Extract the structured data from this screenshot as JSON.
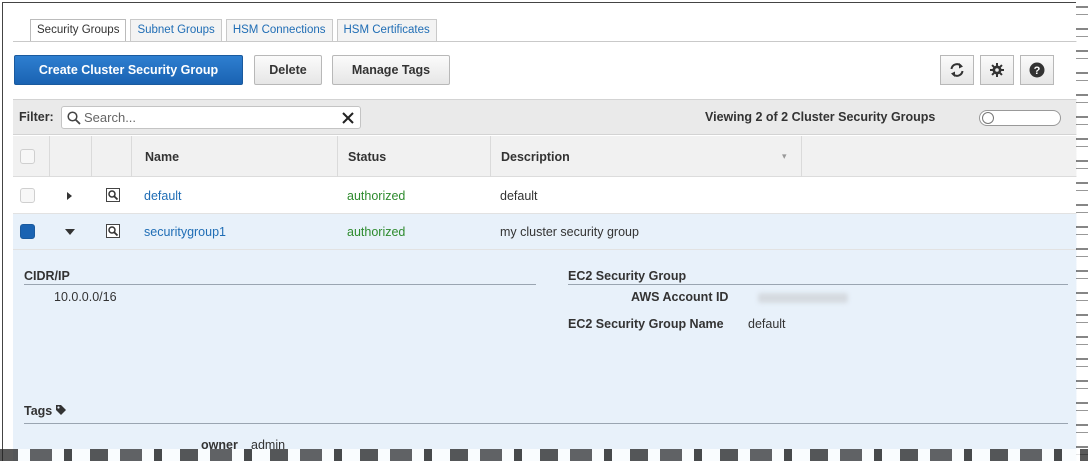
{
  "tabs": [
    "Security Groups",
    "Subnet Groups",
    "HSM Connections",
    "HSM Certificates"
  ],
  "toolbar": {
    "create_label": "Create Cluster Security Group",
    "delete_label": "Delete",
    "manage_tags_label": "Manage Tags"
  },
  "icons": [
    "refresh-icon",
    "gear-icon",
    "help-icon"
  ],
  "filter": {
    "label": "Filter:",
    "search_placeholder": "Search...",
    "viewing": "Viewing 2 of 2 Cluster Security Groups"
  },
  "table": {
    "columns": [
      "Name",
      "Status",
      "Description"
    ],
    "rows": [
      {
        "name": "default",
        "status": "authorized",
        "description": "default"
      },
      {
        "name": "securitygroup1",
        "status": "authorized",
        "description": "my cluster security group"
      }
    ]
  },
  "detail": {
    "cidr_header": "CIDR/IP",
    "cidr_value": "10.0.0.0/16",
    "ec2_header": "EC2 Security Group",
    "aws_account_label": "AWS Account ID",
    "ec2_name_label": "EC2 Security Group Name",
    "ec2_name_value": "default",
    "tags_header": "Tags",
    "tag_key": "owner",
    "tag_value": "admin"
  },
  "colors": {
    "primary": "#1a63b2",
    "link": "#1f6db5",
    "status_ok": "#2e8b2e",
    "selected_row": "#e8f1fa"
  }
}
